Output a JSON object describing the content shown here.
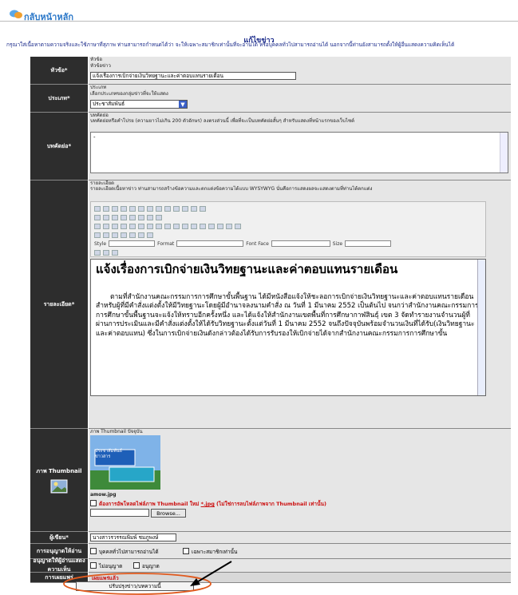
{
  "topbar": {
    "home_link": "กลับหน้าหลัก",
    "home_icon": "speech-bubbles-icon"
  },
  "page": {
    "title": "แก้ไขข่าว",
    "instructions": "กรุณาใส่เนื้อหาตามความจริงและใช้ภาษาที่สุภาพ ท่านสามารถกำหนดได้ว่า จะให้เฉพาะสมาชิกเท่านั้นที่จะอ่านได้ หรือบุคคลทั่วไปสามารถอ่านได้ นอกจากนี้ท่านยังสามารถตั้งให้ผู้อื่นแสดงความคิดเห็นได้"
  },
  "form": {
    "topic": {
      "label": "หัวข้อ*",
      "hint1": "หัวข้อ",
      "hint2": "หัวข้อข่าว",
      "value": "แจ้งเรื่องการเบิกจ่ายเงินวิทยฐานะและค่าตอบแทนรายเดือน"
    },
    "category": {
      "label": "ประเภท*",
      "hint1": "ประเภท",
      "hint2": "เลือกประเภทของกลุ่มข่าวที่จะให้แสดง",
      "value": "ประชาสัมพันธ์"
    },
    "summary": {
      "label": "บทคัดย่อ*",
      "hint1": "บทคัดย่อ",
      "hint2": "บทคัดย่อหรือคำโปรย (ความยาวไม่เกิน 200 ตัวอักษร) ลงตรงส่วนนี้ เพื่อที่จะเป็นบทคัดย่อสั้นๆ สำหรับแสดงที่หน้าแรกของเว็บไซต์",
      "value": "-"
    },
    "details": {
      "label": "รายละเอียด*",
      "hint1": "รายละเอียด",
      "hint2": "รายละเอียดเนื้อหาข่าว ท่านสามารถสร้างข้อความและตกแต่งข้อความได้แบบ WYSYWYG นั่นคือการแสดงผลจะแสดงตามที่ท่านได้ตกแต่ง",
      "font_labels": {
        "style": "Style",
        "format": "Format",
        "font": "Font Face",
        "size": "Size"
      },
      "editor_title": "แจ้งเรื่องการเบิกจ่ายเงินวิทยฐานะและค่าตอบแทนรายเดือน",
      "editor_body": "ตามที่สำนักงานคณะกรรมการการศึกษาขั้นพื้นฐาน ได้มีหนังสือแจ้งให้ชะลอการเบิกจ่ายเงินวิทยฐานะและค่าตอบแทนรายเดือน สำหรับผู้ที่มีคำสั่งแต่งตั้งให้มีวิทยฐานะโดยผู้มีอำนาจลงนามคำสั่ง ณ วันที่ 1 มีนาคม 2552 เป็นต้นไป จนกว่าสำนักงานคณะกรรมการการศึกษาขั้นพื้นฐานจะแจ้งให้ทราบอีกครั้งหนึ่ง และได้แจ้งให้สำนักงานเขตพื้นที่การศึกษากาฬสินธุ์ เขต 3 จัดทำรายงานจำนวนผู้ที่ผ่านการประเมินและมีคำสั่งแต่งตั้งให้ได้รับวิทยฐานะตั้งแต่วันที่ 1 มีนาคม 2552 จนถึงปัจจุบันพร้อมจำนวนเงินที่ได้รับ(เงินวิทยฐานะและค่าตอบแทน) ซึ่งในการเบิกจ่ายเงินดังกล่าวต้องได้รับการรับรองให้เบิกจ่ายได้จากสำนักงานคณะกรรมการการศึกษาขั้น"
    },
    "thumbnail": {
      "label": "ภาพ Thumbnail",
      "hint": "ภาพ Thumbnail ปัจจุบัน",
      "filename": "amow.jpg",
      "sign_text": "ประชาสัมพันธ์ข่าวสาร",
      "delete_note": "ต้องการอัพโหลดไฟล์ภาพ Thumbnail ใหม่",
      "ext": "*.jpg",
      "ext_note": "(ไม่ใช่การลบไฟล์ภาพจาก Thumbnail เท่านั้น)",
      "browse_label": "Browse...",
      "icon": "picture-icon"
    },
    "author": {
      "label": "ผู้เขียน*",
      "value": "นางสาวรวรรณพิมพ์ ชมภูพงษ์"
    },
    "permission": {
      "label": "การอนุญาตให้อ่าน",
      "opt_public": "บุคคลทั่วไปสามารถอ่านได้",
      "opt_members": "เฉพาะสมาชิกเท่านั้น"
    },
    "comments": {
      "label": "อนุญาตให้ผู้อ่านแสดงความเห็น",
      "opt_no": "ไม่อนุญาต",
      "opt_yes": "อนุญาต"
    },
    "submit": {
      "label": "การเผยแพร่",
      "status": "เผยแพร่แล้ว",
      "button": "ปรับปรุงข่าว/บทความนี้"
    }
  },
  "colors": {
    "label_bg": "#2d2d2d",
    "field_bg": "#e6e6e6",
    "link": "#2a77c8",
    "annotation": "#e05a1e",
    "bottom_bar": "#f2b55a"
  }
}
